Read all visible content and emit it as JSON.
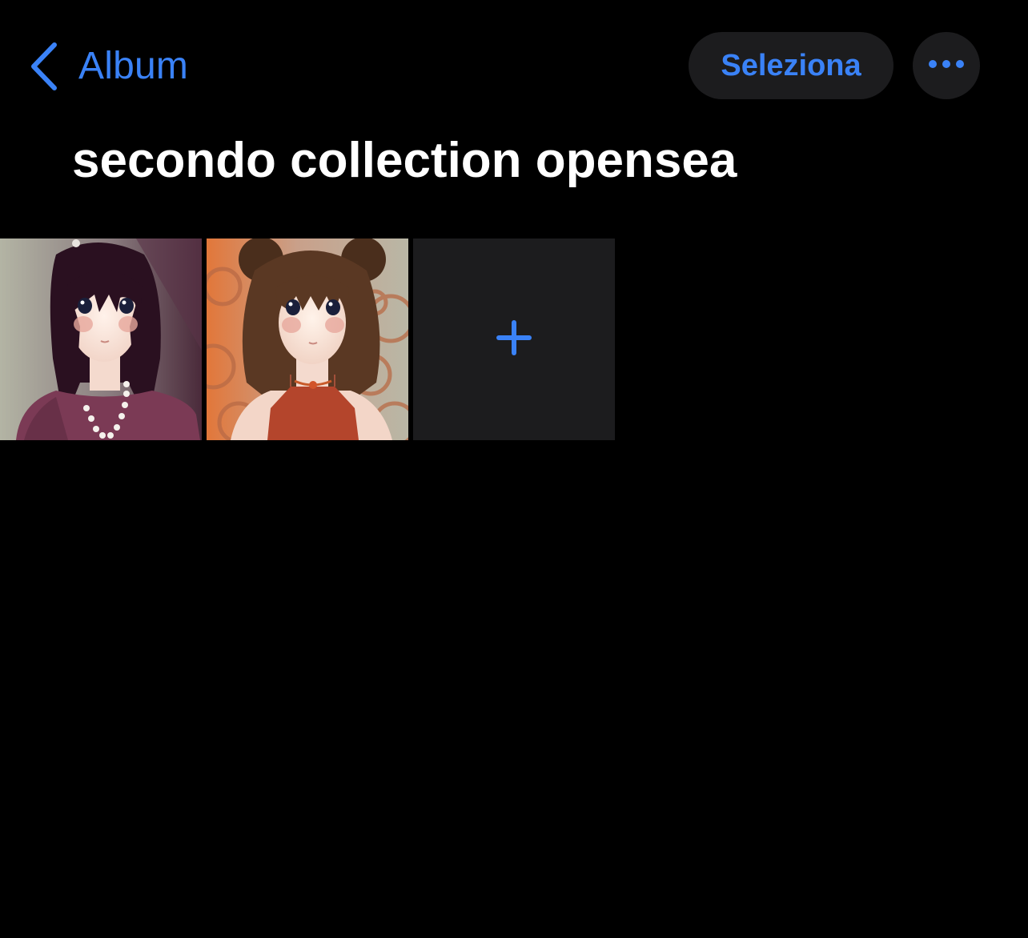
{
  "nav": {
    "back_label": "Album",
    "back_icon": "chevron-left-icon",
    "select_label": "Seleziona",
    "more_icon": "ellipsis-icon"
  },
  "album": {
    "title": "secondo collection opensea",
    "photos": [
      {
        "description_icon": "photo-thumbnail"
      },
      {
        "description_icon": "photo-thumbnail"
      }
    ],
    "add_icon": "plus-icon"
  },
  "colors": {
    "accent": "#3a82f7",
    "background": "#000000",
    "control_background": "#1c1c1e",
    "title_text": "#ffffff"
  }
}
